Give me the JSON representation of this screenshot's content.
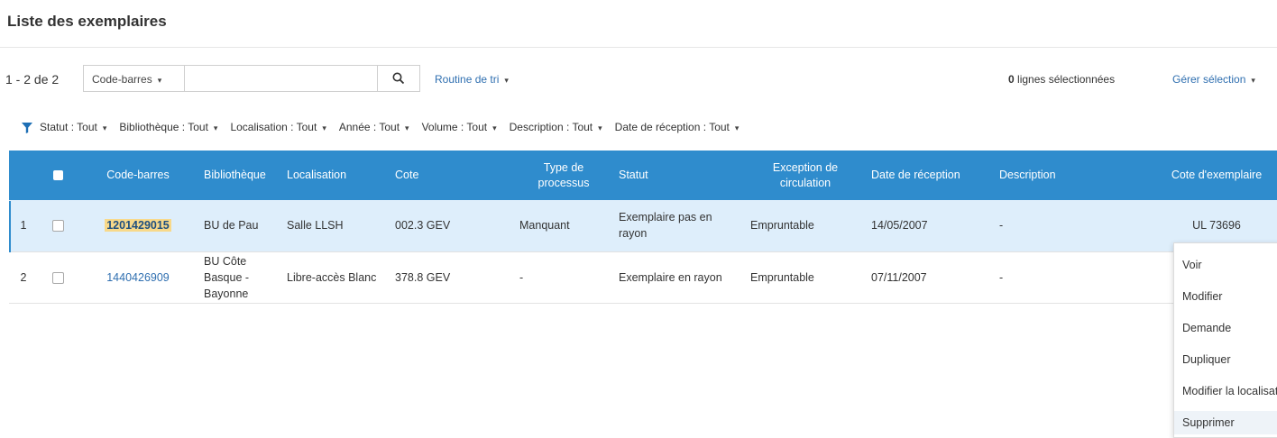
{
  "page": {
    "title": "Liste des exemplaires"
  },
  "toolbar": {
    "count": "1 - 2 de 2",
    "search_type": "Code-barres",
    "search_value": "",
    "search_placeholder": "",
    "sort_label": "Routine de tri",
    "selected_count": "0",
    "selected_label": "lignes sélectionnées",
    "manage_label": "Gérer sélection"
  },
  "filters": [
    {
      "label": "Statut :",
      "value": "Tout"
    },
    {
      "label": "Bibliothèque :",
      "value": "Tout"
    },
    {
      "label": "Localisation :",
      "value": "Tout"
    },
    {
      "label": "Année :",
      "value": "Tout"
    },
    {
      "label": "Volume :",
      "value": "Tout"
    },
    {
      "label": "Description :",
      "value": "Tout"
    },
    {
      "label": "Date de réception :",
      "value": "Tout"
    }
  ],
  "table": {
    "columns": [
      "Code-barres",
      "Bibliothèque",
      "Localisation",
      "Cote",
      "Type de processus",
      "Statut",
      "Exception de circulation",
      "Date de réception",
      "Description",
      "Cote d'exemplaire"
    ],
    "rows": [
      {
        "num": "1",
        "barcode": "1201429015",
        "library": "BU de Pau",
        "location": "Salle LLSH",
        "call": "002.3 GEV",
        "process": "Manquant",
        "status": "Exemplaire pas en rayon",
        "circ": "Empruntable",
        "date": "14/05/2007",
        "desc": "-",
        "item_call": "UL 73696"
      },
      {
        "num": "2",
        "barcode": "1440426909",
        "library": "BU Côte Basque - Bayonne",
        "location": "Libre-accès Blanc",
        "call": "378.8 GEV",
        "process": "-",
        "status": "Exemplaire en rayon",
        "circ": "Empruntable",
        "date": "07/11/2007",
        "desc": "-",
        "item_call": ""
      }
    ]
  },
  "context_menu": [
    "Voir",
    "Modifier",
    "Demande",
    "Dupliquer",
    "Modifier la localisation",
    "Supprimer"
  ],
  "colors": {
    "header_bg": "#2f8ccd",
    "selected_row": "#deeefb",
    "link": "#2f6fb0",
    "highlight": "#f8d98a"
  },
  "icons": {
    "search": "search-icon",
    "filter": "funnel-icon",
    "caret": "caret-down-icon"
  }
}
